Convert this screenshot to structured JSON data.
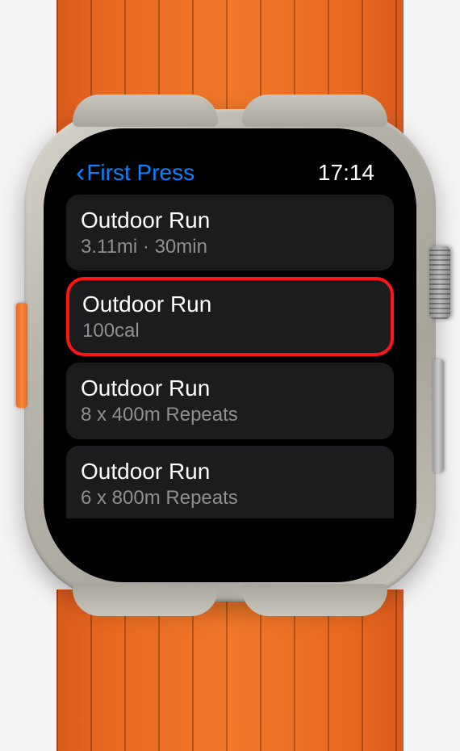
{
  "status_bar": {
    "back_label": "First Press",
    "time": "17:14"
  },
  "accent_color": "#0a84ff",
  "highlight_color": "#ff1418",
  "list": {
    "items": [
      {
        "title": "Outdoor Run",
        "subtitle": "3.11mi · 30min",
        "highlighted": false
      },
      {
        "title": "Outdoor Run",
        "subtitle": "100cal",
        "highlighted": true
      },
      {
        "title": "Outdoor Run",
        "subtitle": "8 x 400m Repeats",
        "highlighted": false
      },
      {
        "title": "Outdoor Run",
        "subtitle": "6 x 800m Repeats",
        "highlighted": false
      }
    ]
  }
}
